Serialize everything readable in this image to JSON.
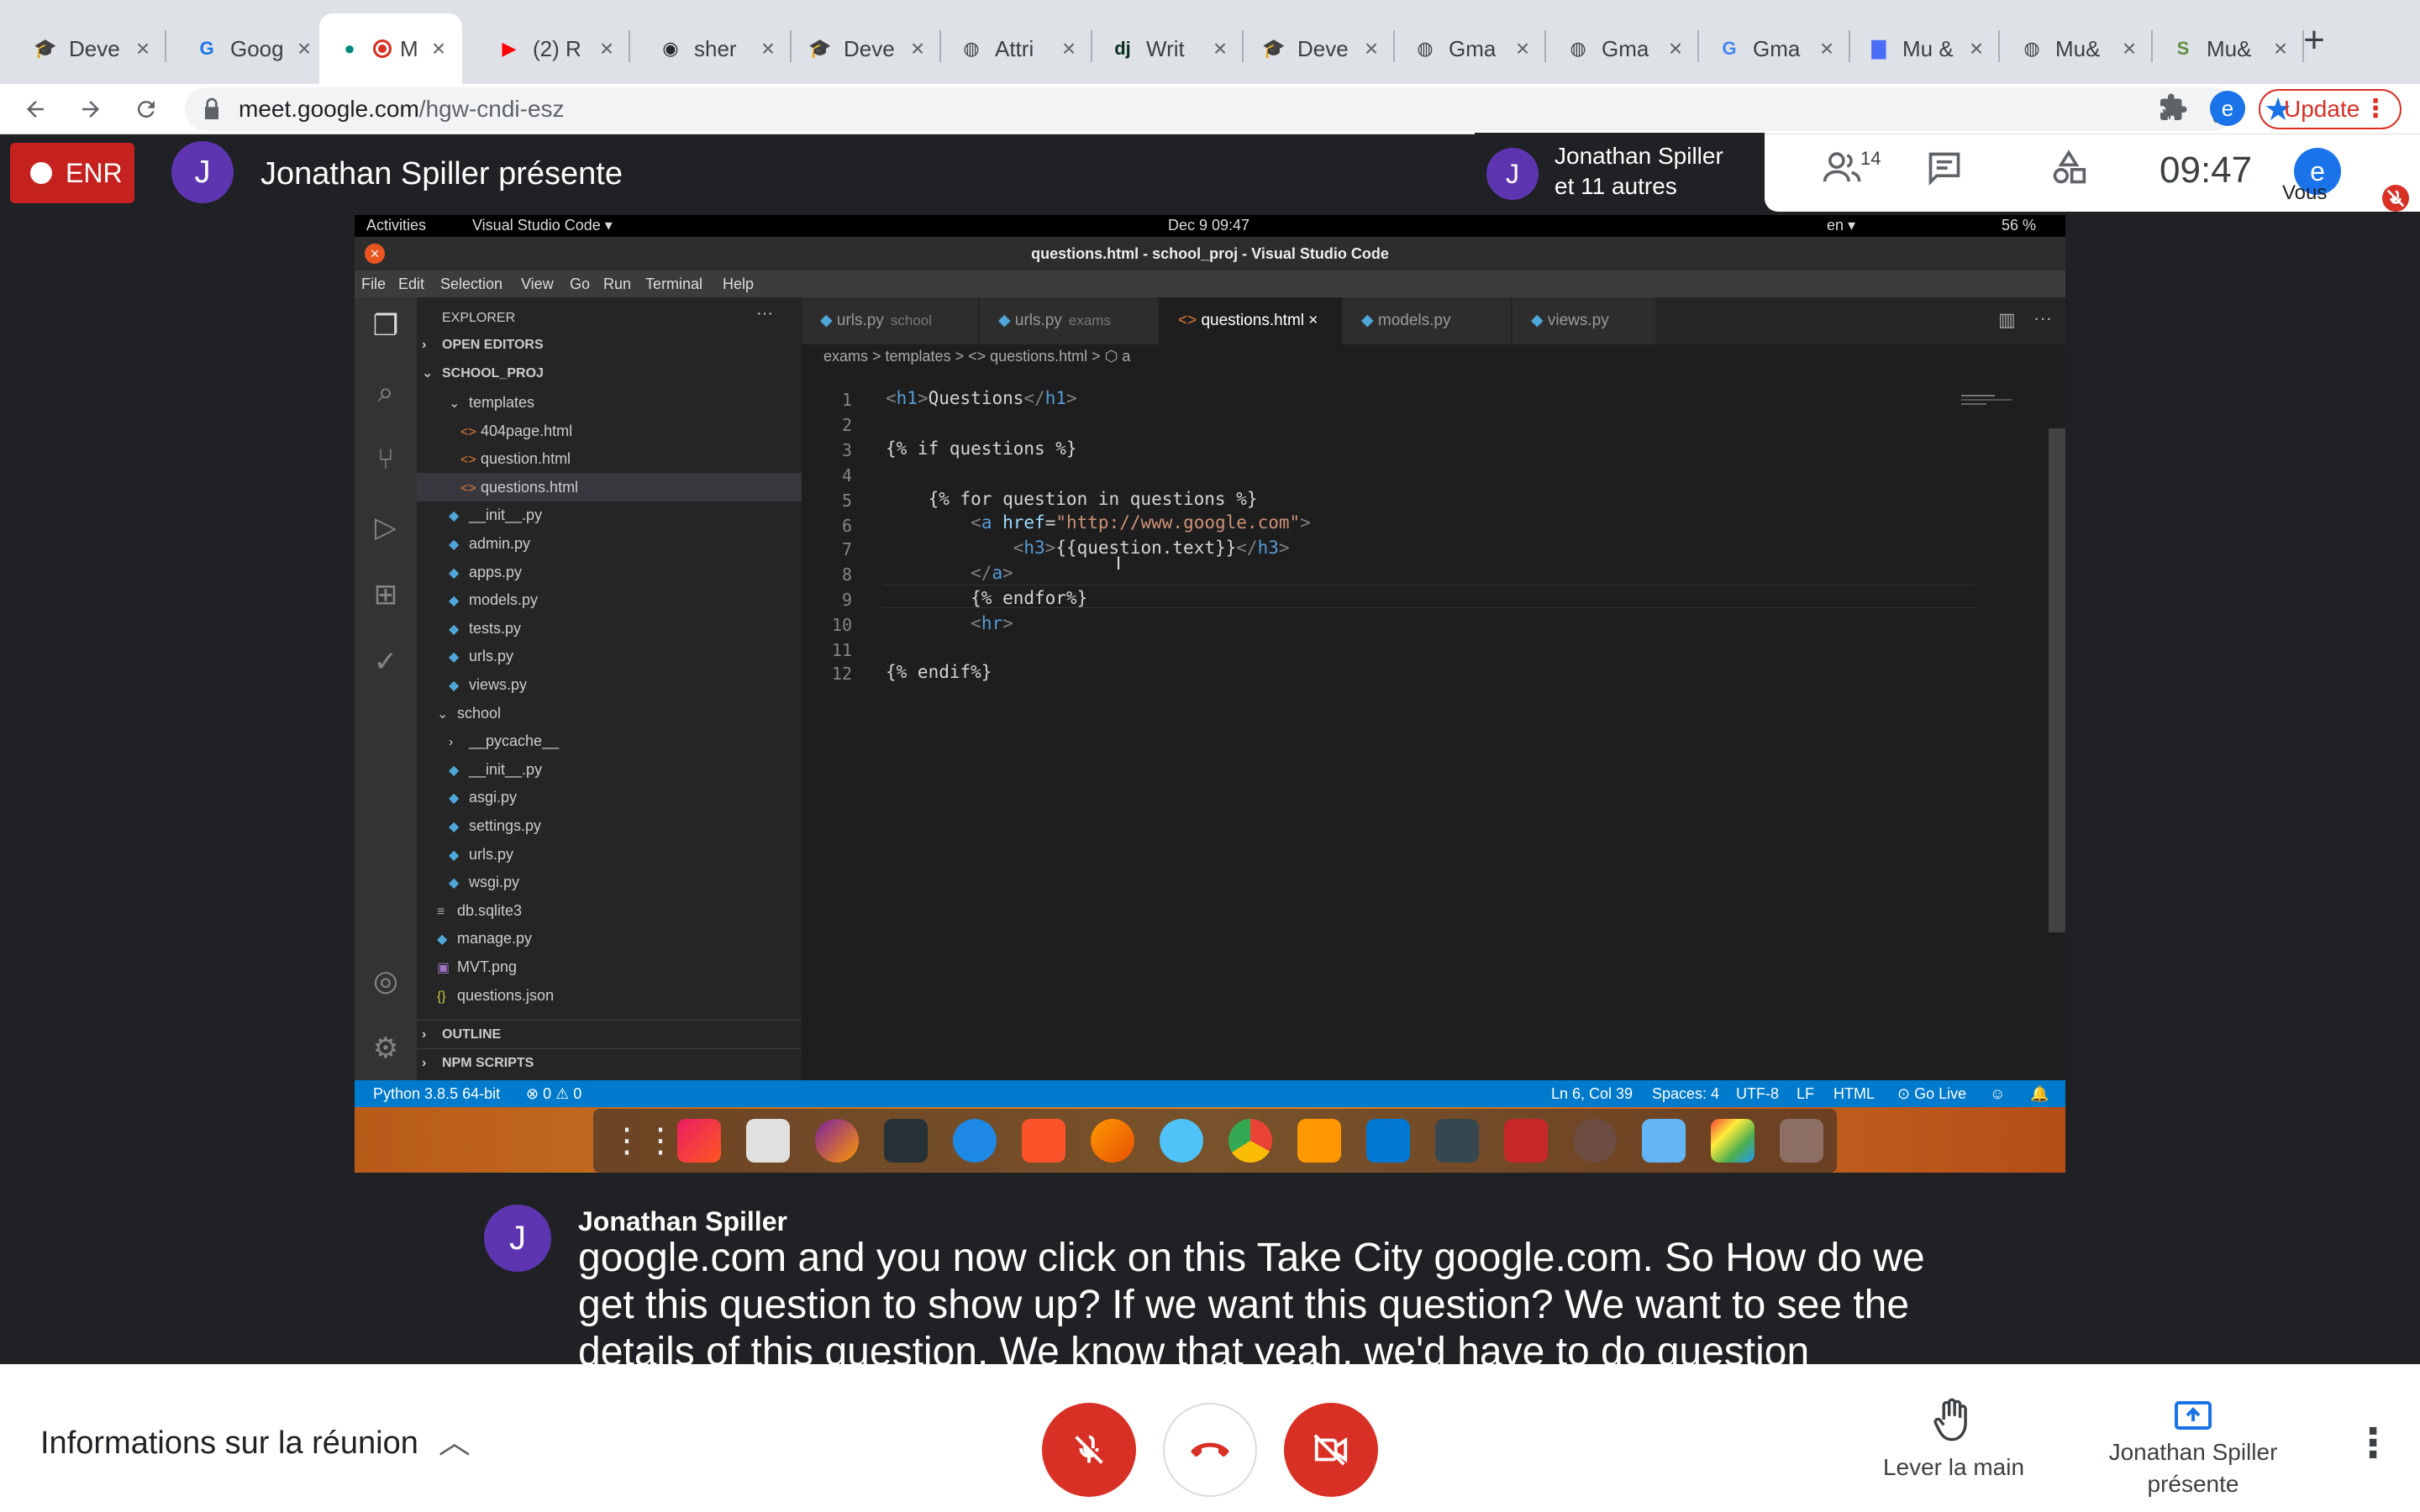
{
  "browser": {
    "tabs": [
      {
        "title": "Deve",
        "fav": "mortarboard-icon",
        "sym": "🎓",
        "color": "#3c4043"
      },
      {
        "title": "Goog",
        "fav": "translate-icon",
        "sym": "G",
        "color": "#1a73e8"
      },
      {
        "title": "M",
        "fav": "meet-icon",
        "sym": "●",
        "color": "#00897b",
        "active": true
      },
      {
        "title": "(2) R",
        "fav": "youtube-icon",
        "sym": "▶",
        "color": "#ff0000"
      },
      {
        "title": "sher",
        "fav": "github-icon",
        "sym": "◉",
        "color": "#24292e"
      },
      {
        "title": "Deve",
        "fav": "mortarboard-icon",
        "sym": "🎓",
        "color": "#3c4043"
      },
      {
        "title": "Attri",
        "fav": "globe-icon",
        "sym": "◍",
        "color": "#3c4043"
      },
      {
        "title": "Writ",
        "fav": "django-icon",
        "sym": "dj",
        "color": "#092e20"
      },
      {
        "title": "Deve",
        "fav": "mortarboard-icon",
        "sym": "🎓",
        "color": "#3c4043"
      },
      {
        "title": "Gma",
        "fav": "globe-icon",
        "sym": "◍",
        "color": "#3c4043"
      },
      {
        "title": "Gma",
        "fav": "globe-icon",
        "sym": "◍",
        "color": "#3c4043"
      },
      {
        "title": "Gma",
        "fav": "google-icon",
        "sym": "G",
        "color": "#4285f4"
      },
      {
        "title": "Mu &",
        "fav": "docs-icon",
        "sym": "▇",
        "color": "#4a6cf7"
      },
      {
        "title": "Mu&",
        "fav": "globe-icon",
        "sym": "◍",
        "color": "#3c4043"
      },
      {
        "title": "Mu&",
        "fav": "shopify-icon",
        "sym": "S",
        "color": "#5e8e3e"
      }
    ],
    "url_host": "meet.google.com",
    "url_path": "/hgw-cndi-esz",
    "update_label": "Update",
    "profile_initial": "e"
  },
  "meet": {
    "rec_label": "ENR",
    "presenter_initial": "J",
    "presenter_line": "Jonathan Spiller présente",
    "panel_name": "Jonathan Spiller",
    "panel_others": "et 11 autres",
    "people_count": "14",
    "clock": "09:47",
    "self_initial": "e",
    "self_label": "Vous",
    "caption_name": "Jonathan Spiller",
    "caption_text": "google.com and you now click on this Take City google.com. So How do we get this question to show up? If we want this question? We want to see the details of this question. We know that yeah, we'd have to do question",
    "meeting_info": "Informations sur la réunion",
    "raise_hand": "Lever la main",
    "presenting_label": "Jonathan Spiller présente"
  },
  "vscode": {
    "gnome_activities": "Activities",
    "gnome_app": "Visual Studio Code ▾",
    "gnome_date": "Dec 9  09:47",
    "gnome_lang": "en ▾",
    "gnome_battery": "56 %",
    "title": "questions.html - school_proj - Visual Studio Code",
    "menu": [
      "File",
      "Edit",
      "Selection",
      "View",
      "Go",
      "Run",
      "Terminal",
      "Help"
    ],
    "explorer_title": "EXPLORER",
    "open_editors": "OPEN EDITORS",
    "project": "SCHOOL_PROJ",
    "tree": [
      {
        "label": "templates",
        "indent": 1,
        "kind": "folder-open"
      },
      {
        "label": "404page.html",
        "indent": 2,
        "kind": "html"
      },
      {
        "label": "question.html",
        "indent": 2,
        "kind": "html"
      },
      {
        "label": "questions.html",
        "indent": 2,
        "kind": "html",
        "selected": true
      },
      {
        "label": "__init__.py",
        "indent": 1,
        "kind": "py"
      },
      {
        "label": "admin.py",
        "indent": 1,
        "kind": "py"
      },
      {
        "label": "apps.py",
        "indent": 1,
        "kind": "py"
      },
      {
        "label": "models.py",
        "indent": 1,
        "kind": "py"
      },
      {
        "label": "tests.py",
        "indent": 1,
        "kind": "py"
      },
      {
        "label": "urls.py",
        "indent": 1,
        "kind": "py"
      },
      {
        "label": "views.py",
        "indent": 1,
        "kind": "py"
      },
      {
        "label": "school",
        "indent": 0,
        "kind": "folder-open"
      },
      {
        "label": "__pycache__",
        "indent": 1,
        "kind": "folder"
      },
      {
        "label": "__init__.py",
        "indent": 1,
        "kind": "py"
      },
      {
        "label": "asgi.py",
        "indent": 1,
        "kind": "py"
      },
      {
        "label": "settings.py",
        "indent": 1,
        "kind": "py"
      },
      {
        "label": "urls.py",
        "indent": 1,
        "kind": "py"
      },
      {
        "label": "wsgi.py",
        "indent": 1,
        "kind": "py"
      },
      {
        "label": "db.sqlite3",
        "indent": 0,
        "kind": "db"
      },
      {
        "label": "manage.py",
        "indent": 0,
        "kind": "py"
      },
      {
        "label": "MVT.png",
        "indent": 0,
        "kind": "img"
      },
      {
        "label": "questions.json",
        "indent": 0,
        "kind": "json"
      }
    ],
    "outline": "OUTLINE",
    "npm": "NPM SCRIPTS",
    "tabs": [
      {
        "label": "urls.py",
        "sub": "school"
      },
      {
        "label": "urls.py",
        "sub": "exams"
      },
      {
        "label": "questions.html",
        "sub": "",
        "active": true
      },
      {
        "label": "models.py",
        "sub": ""
      },
      {
        "label": "views.py",
        "sub": ""
      }
    ],
    "breadcrumb": "exams  >  templates  >  <>  questions.html  >  ⬡  a",
    "status": {
      "python": "Python 3.8.5 64-bit",
      "problems": "⊗ 0 ⚠ 0",
      "position": "Ln 6, Col 39",
      "spaces": "Spaces: 4",
      "encoding": "UTF-8",
      "eol": "LF",
      "language": "HTML",
      "golive": "⊙ Go Live"
    }
  }
}
